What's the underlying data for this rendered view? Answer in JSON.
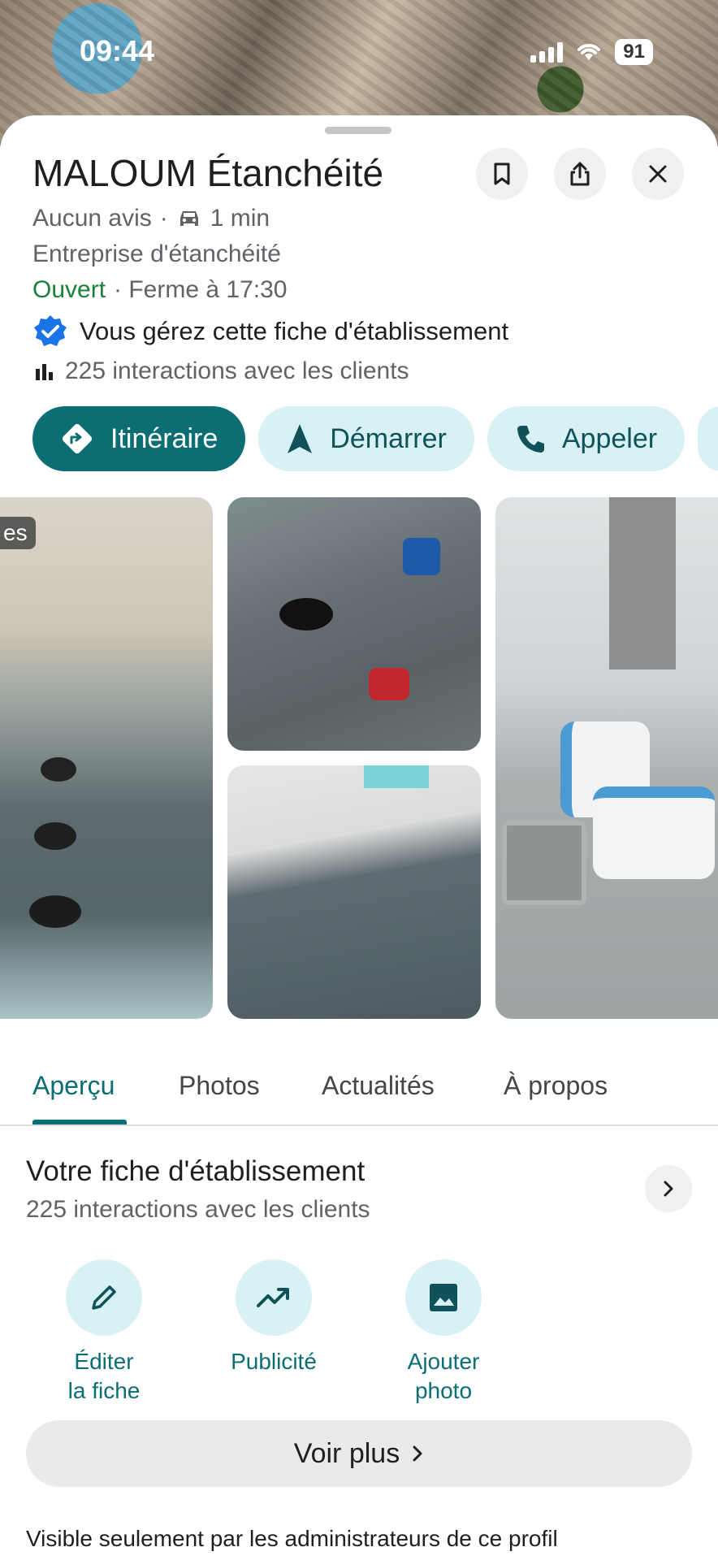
{
  "status_bar": {
    "time": "09:44",
    "battery": "91"
  },
  "place": {
    "name": "MALOUM Étanchéité",
    "reviews": "Aucun avis",
    "drive_time": "1 min",
    "category": "Entreprise d'étanchéité",
    "open_status": "Ouvert",
    "closing": "· Ferme à 17:30",
    "verified_text": "Vous gérez cette fiche d'établissement",
    "interactions": "225 interactions avec les clients"
  },
  "actions": {
    "directions": "Itinéraire",
    "start": "Démarrer",
    "call": "Appeler"
  },
  "photos": {
    "overlay_label": "es"
  },
  "tabs": [
    "Aperçu",
    "Photos",
    "Actualités",
    "À propos"
  ],
  "business_card": {
    "title": "Votre fiche d'établissement",
    "subtitle": "225 interactions avec les clients"
  },
  "quick_actions": [
    {
      "line1": "Éditer",
      "line2": "la fiche",
      "icon": "pencil-icon"
    },
    {
      "line1": "Publicité",
      "line2": "",
      "icon": "trending-up-icon"
    },
    {
      "line1": "Ajouter",
      "line2": "photo",
      "icon": "image-icon"
    }
  ],
  "see_more": "Voir plus",
  "footer_note": "Visible seulement par les administrateurs de ce profil",
  "colors": {
    "accent": "#0b6e73",
    "open_green": "#188038",
    "pill_bg": "#d8f1f4"
  }
}
